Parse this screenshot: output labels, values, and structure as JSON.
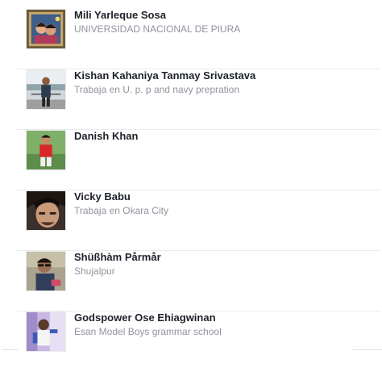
{
  "friends": [
    {
      "name": "Mili Yarleque Sosa",
      "subtitle": "UNIVERSIDAD NACIONAL DE PIURA",
      "subtitle_prefix": "",
      "subtitle_link": "",
      "avatar_icon": "profile-photo-couple"
    },
    {
      "name": "Kishan Kahaniya Tanmay Srivastava",
      "subtitle": "Trabaja en U. p. p and navy prepration",
      "subtitle_prefix": "",
      "subtitle_link": "",
      "avatar_icon": "profile-photo-man-outdoor"
    },
    {
      "name": "Danish Khan",
      "subtitle": "",
      "subtitle_prefix": "",
      "subtitle_link": "",
      "avatar_icon": "profile-photo-man-red-shirt"
    },
    {
      "name": "Vicky Babu",
      "subtitle": "",
      "subtitle_prefix": "Trabaja en ",
      "subtitle_link": "Okara City",
      "avatar_icon": "profile-photo-man-closeup"
    },
    {
      "name": "Shüßhàm Pårmår",
      "subtitle": "Shujalpur",
      "subtitle_prefix": "",
      "subtitle_link": "",
      "avatar_icon": "profile-photo-man-sunglasses"
    },
    {
      "name": "Godspower Ose Ehiagwinan",
      "subtitle": "Esan Model Boys grammar school",
      "subtitle_prefix": "",
      "subtitle_link": "",
      "avatar_icon": "profile-photo-man-purple"
    }
  ],
  "colors": {
    "name": "#1d2129",
    "subtitle": "#90949c",
    "divider": "#e9ebee"
  }
}
